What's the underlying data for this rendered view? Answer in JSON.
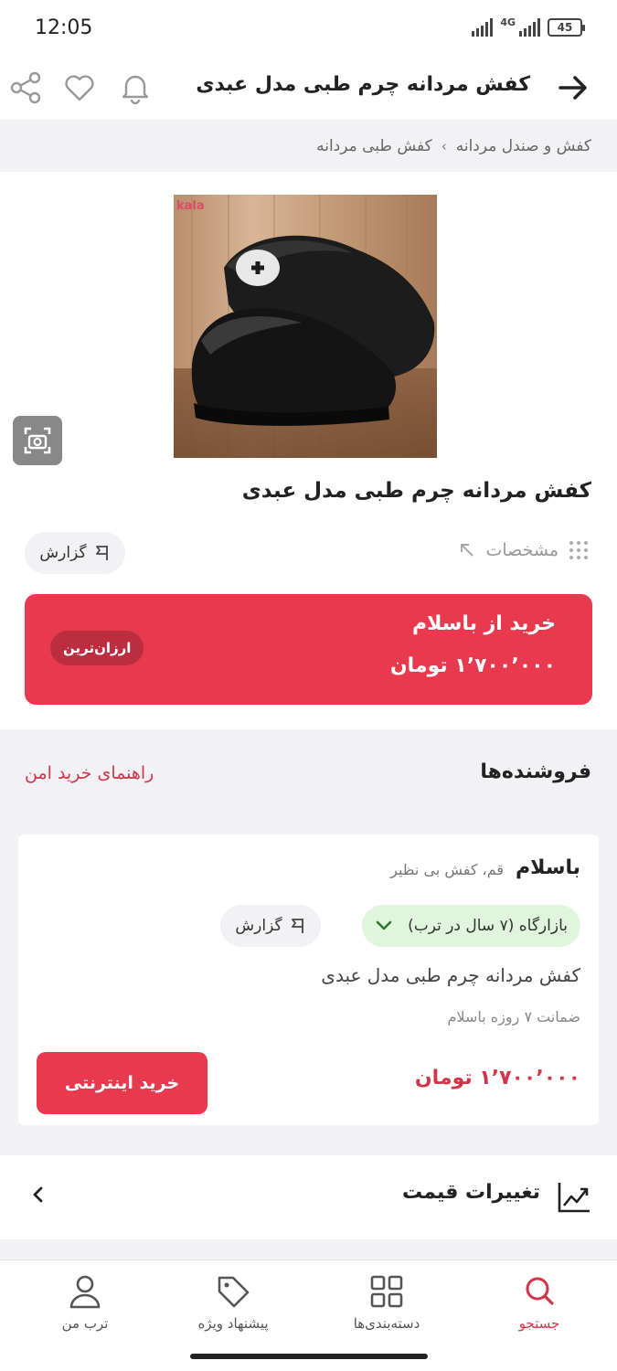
{
  "status_bar": {
    "time": "12:05",
    "network": "4G",
    "battery": "45"
  },
  "header": {
    "title": "کفش مردانه چرم طبی مدل عبدی"
  },
  "breadcrumb": {
    "items": [
      "کفش و صندل مردانه",
      "کفش طبی مردانه"
    ],
    "separator": "›"
  },
  "product": {
    "image_watermark": "kala",
    "title": "کفش مردانه چرم طبی مدل عبدی",
    "specs_label": "مشخصات",
    "report_label": "گزارش"
  },
  "buy_card": {
    "buy_from": "خرید از باسلام",
    "price": "۱٬۷۰۰٬۰۰۰ تومان",
    "badge": "ارزان‌ترین"
  },
  "sellers": {
    "title": "فروشنده‌ها",
    "safe_guide": "راهنمای خرید امن",
    "offer": {
      "seller_name": "باسلام",
      "seller_location": "قم، کفش بی نظیر",
      "market_badge": "بازارگاه (۷ سال در ترب)",
      "report_label": "گزارش",
      "title": "کفش مردانه چرم طبی مدل عبدی",
      "warranty": "ضمانت ۷ روزه باسلام",
      "price": "۱٬۷۰۰٬۰۰۰ تومان",
      "buy_button": "خرید اینترنتی"
    }
  },
  "price_changes": {
    "label": "تغییرات قیمت"
  },
  "bottom_nav": {
    "items": [
      {
        "label": "جستجو",
        "icon": "search-icon",
        "active": true
      },
      {
        "label": "دسته‌بندی‌ها",
        "icon": "grid-icon",
        "active": false
      },
      {
        "label": "پیشنهاد ویژه",
        "icon": "tag-icon",
        "active": false
      },
      {
        "label": "ترب من",
        "icon": "user-icon",
        "active": false
      }
    ]
  },
  "colors": {
    "accent": "#e8394f",
    "accent_text": "#d23448",
    "market_bg": "#dff5dc",
    "gray_bg": "#f2f2f4"
  }
}
